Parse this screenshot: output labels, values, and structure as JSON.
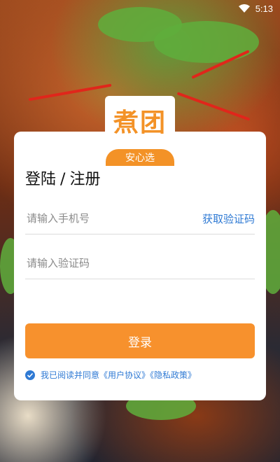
{
  "status": {
    "time": "5:13"
  },
  "brand": {
    "logo_text": "煮团",
    "badge": "安心选"
  },
  "page": {
    "title_login": "登陆",
    "title_sep": "/",
    "title_register": "注册"
  },
  "form": {
    "phone_placeholder": "请输入手机号",
    "get_code_label": "获取验证码",
    "code_placeholder": "请输入验证码",
    "login_label": "登录"
  },
  "agreement": {
    "checked": true,
    "text": "我已阅读并同意《用户协议》《隐私政策》"
  },
  "colors": {
    "accent": "#f7912d",
    "link": "#2f7ad4"
  }
}
